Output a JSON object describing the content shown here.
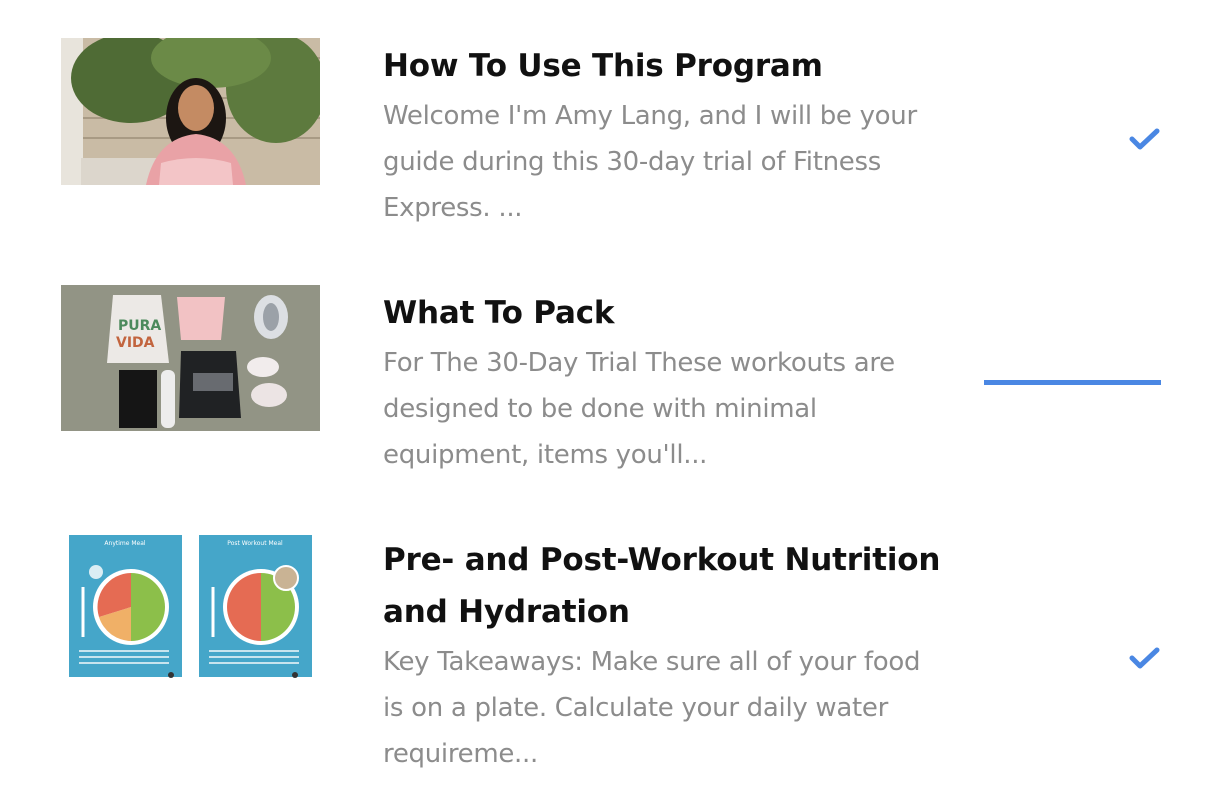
{
  "accent_color": "#4a87e3",
  "lessons": [
    {
      "title": "How To Use This Program",
      "description_lines": [
        "Welcome I'm Amy Lang, and I will be your",
        "guide during this 30-day trial of Fitness",
        "Express. ..."
      ],
      "thumbnail": "video-thumbnail-instructor",
      "status": "completed",
      "status_icon": "checkmark-icon"
    },
    {
      "title": "What To Pack",
      "description_lines": [
        "For The 30-Day Trial These workouts are",
        "designed to be done with minimal",
        "equipment, items you'll..."
      ],
      "thumbnail": "photo-packed-gear",
      "status": "in-progress",
      "progress": 1.0
    },
    {
      "title_lines": [
        "Pre- and Post-Workout Nutrition",
        "and Hydration"
      ],
      "description_lines": [
        "Key Takeaways: Make sure all of your food",
        "is on a plate. Calculate your daily water",
        "requireme..."
      ],
      "thumbnail": "nutrition-plate-infographics",
      "thumbnail_text": [
        "Anytime Meal",
        "Post Workout Meal"
      ],
      "status": "completed",
      "status_icon": "checkmark-icon"
    }
  ]
}
